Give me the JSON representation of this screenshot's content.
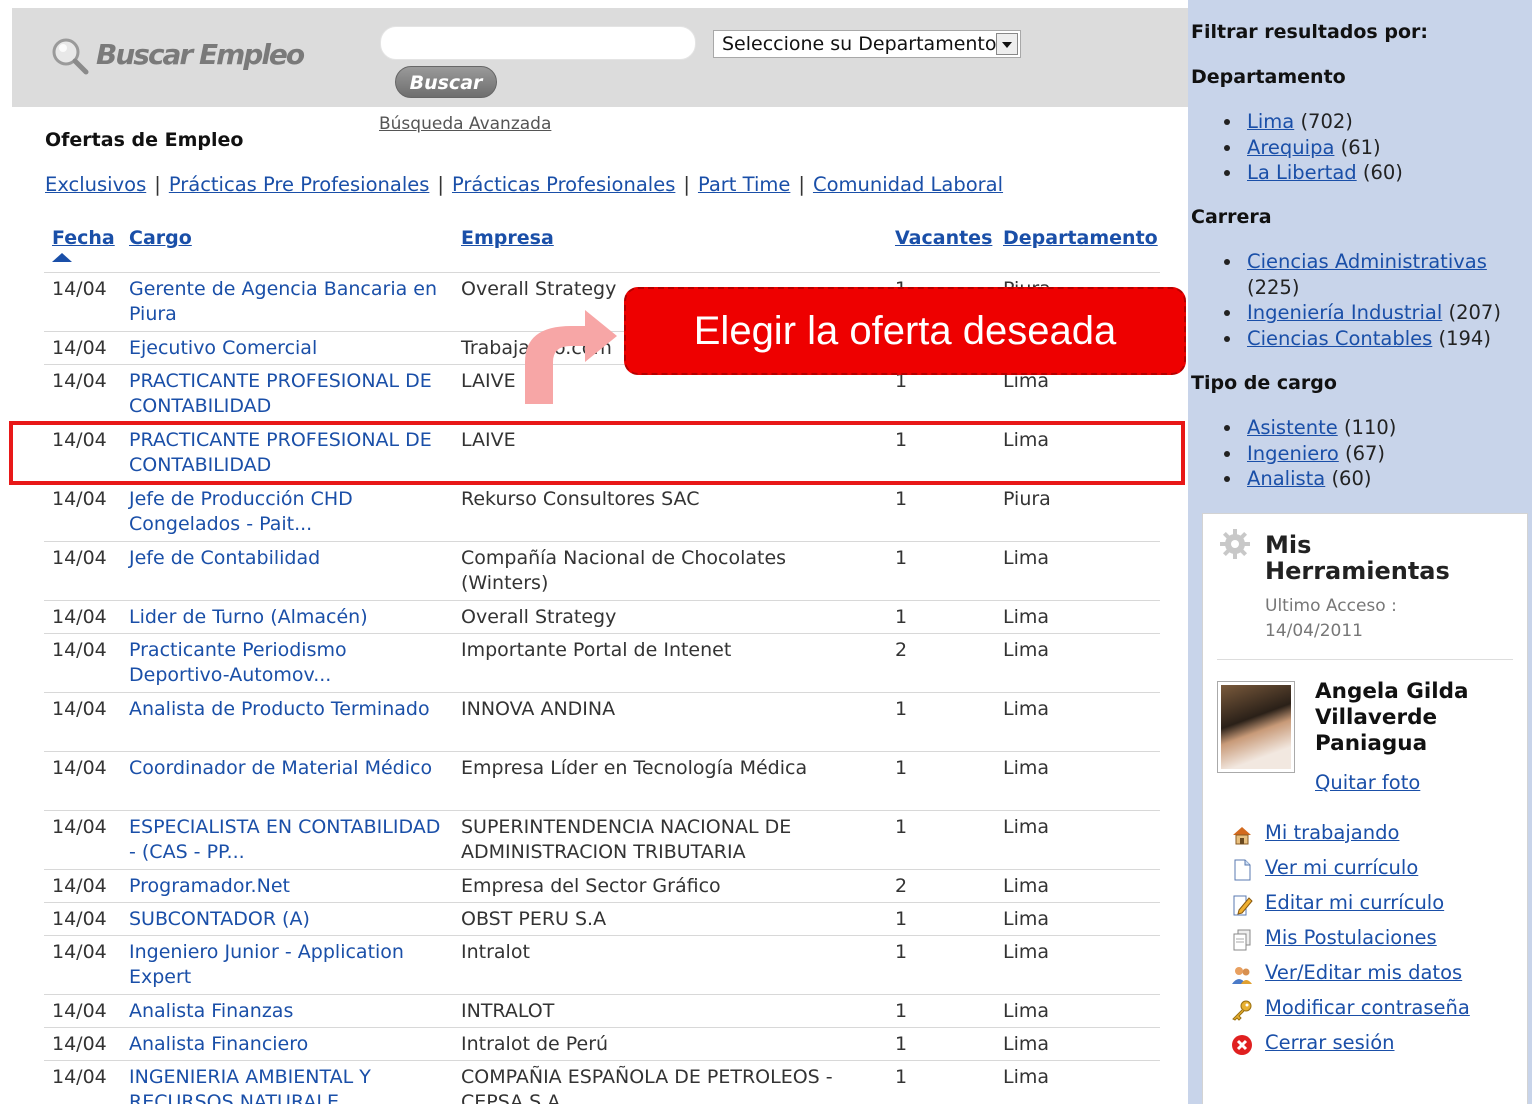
{
  "search": {
    "logo_text": "Buscar Empleo",
    "input_value": "",
    "department_select": "Seleccione su Departamento",
    "button_label": "Buscar",
    "advanced_link": "Búsqueda Avanzada"
  },
  "main": {
    "title": "Ofertas de Empleo",
    "category_links": [
      "Exclusivos",
      "Prácticas Pre Profesionales",
      "Prácticas Profesionales",
      "Part Time",
      "Comunidad Laboral"
    ],
    "columns": {
      "fecha": "Fecha",
      "cargo": "Cargo",
      "empresa": "Empresa",
      "vacantes": "Vacantes",
      "departamento": "Departamento"
    },
    "rows": [
      {
        "fecha": "14/04",
        "cargo": "Gerente de Agencia Bancaria en Piura",
        "empresa": "Overall Strategy",
        "vacantes": "1",
        "departamento": "Piura"
      },
      {
        "fecha": "14/04",
        "cargo": "Ejecutivo Comercial",
        "empresa": "Trabajando.com",
        "vacantes": "",
        "departamento": ""
      },
      {
        "fecha": "14/04",
        "cargo": "PRACTICANTE PROFESIONAL DE CONTABILIDAD",
        "empresa": "LAIVE",
        "vacantes": "1",
        "departamento": "Lima"
      },
      {
        "fecha": "14/04",
        "cargo": "PRACTICANTE PROFESIONAL DE CONTABILIDAD",
        "empresa": "LAIVE",
        "vacantes": "1",
        "departamento": "Lima"
      },
      {
        "fecha": "14/04",
        "cargo": "Jefe de Producción CHD Congelados - Pait...",
        "empresa": "Rekurso Consultores SAC",
        "vacantes": "1",
        "departamento": "Piura"
      },
      {
        "fecha": "14/04",
        "cargo": "Jefe de Contabilidad",
        "empresa": "Compañía Nacional de Chocolates (Winters)",
        "vacantes": "1",
        "departamento": "Lima"
      },
      {
        "fecha": "14/04",
        "cargo": "Lider de Turno (Almacén)",
        "empresa": "Overall Strategy",
        "vacantes": "1",
        "departamento": "Lima"
      },
      {
        "fecha": "14/04",
        "cargo": "Practicante Periodismo Deportivo-Automov...",
        "empresa": "Importante Portal de Intenet",
        "vacantes": "2",
        "departamento": "Lima"
      },
      {
        "fecha": "14/04",
        "cargo": "Analista de Producto Terminado",
        "empresa": "INNOVA ANDINA",
        "vacantes": "1",
        "departamento": "Lima"
      },
      {
        "fecha": "14/04",
        "cargo": "Coordinador de Material Médico",
        "empresa": "Empresa Líder en Tecnología Médica",
        "vacantes": "1",
        "departamento": "Lima"
      },
      {
        "fecha": "14/04",
        "cargo": "ESPECIALISTA EN CONTABILIDAD - (CAS - PP...",
        "empresa": "SUPERINTENDENCIA NACIONAL DE ADMINISTRACION TRIBUTARIA",
        "vacantes": "1",
        "departamento": "Lima"
      },
      {
        "fecha": "14/04",
        "cargo": "Programador.Net",
        "empresa": "Empresa del Sector Gráfico",
        "vacantes": "2",
        "departamento": "Lima"
      },
      {
        "fecha": "14/04",
        "cargo": "SUBCONTADOR (A)",
        "empresa": "OBST PERU S.A",
        "vacantes": "1",
        "departamento": "Lima"
      },
      {
        "fecha": "14/04",
        "cargo": "Ingeniero Junior - Application Expert",
        "empresa": "Intralot",
        "vacantes": "1",
        "departamento": "Lima"
      },
      {
        "fecha": "14/04",
        "cargo": "Analista Finanzas",
        "empresa": "INTRALOT",
        "vacantes": "1",
        "departamento": "Lima"
      },
      {
        "fecha": "14/04",
        "cargo": "Analista Financiero",
        "empresa": "Intralot de Perú",
        "vacantes": "1",
        "departamento": "Lima"
      },
      {
        "fecha": "14/04",
        "cargo": "INGENIERIA AMBIENTAL Y RECURSOS NATURALE...",
        "empresa": "COMPAÑIA ESPAÑOLA DE PETROLEOS - CEPSA S.A",
        "vacantes": "1",
        "departamento": "Lima"
      }
    ],
    "callout_text": "Elegir la oferta deseada"
  },
  "sidebar": {
    "title": "Filtrar resultados por:",
    "sections": [
      {
        "heading": "Departamento",
        "items": [
          {
            "label": "Lima",
            "count": "(702)"
          },
          {
            "label": "Arequipa",
            "count": "(61)"
          },
          {
            "label": "La Libertad",
            "count": "(60)"
          }
        ]
      },
      {
        "heading": "Carrera",
        "items": [
          {
            "label": "Ciencias Administrativas",
            "count": "(225)"
          },
          {
            "label": "Ingeniería Industrial",
            "count": "(207)"
          },
          {
            "label": "Ciencias Contables",
            "count": "(194)"
          }
        ]
      },
      {
        "heading": "Tipo de cargo",
        "items": [
          {
            "label": "Asistente",
            "count": "(110)"
          },
          {
            "label": "Ingeniero",
            "count": "(67)"
          },
          {
            "label": "Analista",
            "count": "(60)"
          }
        ]
      }
    ],
    "tools": {
      "title": "Mis Herramientas",
      "last_access": "Ultimo Acceso : 14/04/2011",
      "user_name": "Angela Gilda Villaverde Paniagua",
      "remove_photo": "Quitar foto",
      "items": [
        {
          "label": "Mi trabajando",
          "icon": "home-icon"
        },
        {
          "label": "Ver mi currículo",
          "icon": "document-icon"
        },
        {
          "label": "Editar mi currículo",
          "icon": "edit-document-icon"
        },
        {
          "label": "Mis Postulaciones",
          "icon": "documents-icon"
        },
        {
          "label": "Ver/Editar mis datos",
          "icon": "users-icon"
        },
        {
          "label": "Modificar contraseña",
          "icon": "key-icon"
        },
        {
          "label": "Cerrar sesión",
          "icon": "close-circle-icon"
        }
      ]
    }
  },
  "colors": {
    "link": "#1a4fa8",
    "highlight": "#e81818",
    "callout": "#ee0000",
    "sidebar_bg": "#c8d4ea",
    "searchbar_bg": "#dcdcdc"
  }
}
